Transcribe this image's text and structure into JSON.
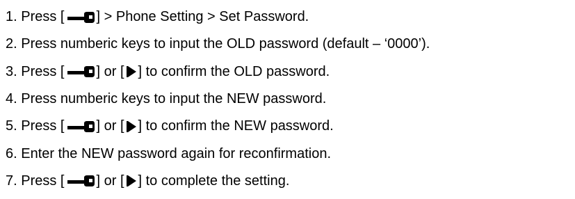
{
  "icons": {
    "menu_key": "menu-key-icon",
    "play": "play-icon"
  },
  "steps": [
    {
      "number": "1.",
      "lead": "Press [",
      "mid": "",
      "tail": "] > Phone Setting > Set Password."
    },
    {
      "number": "2.",
      "text": "Press numberic keys to input the OLD password (default – ‘0000’)."
    },
    {
      "number": "3.",
      "lead": "Press [",
      "mid": "] or [",
      "tail": "] to confirm the OLD password."
    },
    {
      "number": "4.",
      "text": "Press numberic keys to input the NEW password."
    },
    {
      "number": "5.",
      "lead": "Press [",
      "mid": "] or [",
      "tail": "] to confirm the NEW password."
    },
    {
      "number": "6.",
      "text": "Enter the NEW password again for reconfirmation."
    },
    {
      "number": "7.",
      "lead": "Press [",
      "mid": "] or [",
      "tail": "] to complete the setting."
    }
  ]
}
